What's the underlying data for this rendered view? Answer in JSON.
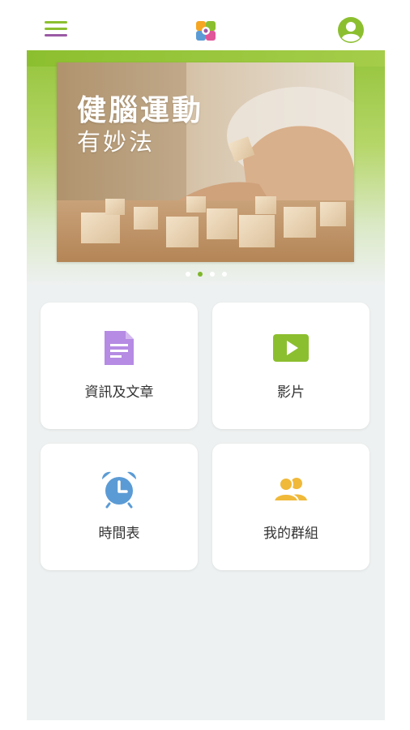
{
  "banner": {
    "title": "健腦運動",
    "subtitle": "有妙法",
    "slide_count": 4,
    "active_slide": 2
  },
  "tiles": [
    {
      "label": "資訊及文章",
      "icon": "document-icon",
      "color": "#b58be3"
    },
    {
      "label": "影片",
      "icon": "play-video-icon",
      "color": "#8cbf2f"
    },
    {
      "label": "時間表",
      "icon": "alarm-clock-icon",
      "color": "#5b9bd5"
    },
    {
      "label": "我的群組",
      "icon": "group-people-icon",
      "color": "#f0b93a"
    }
  ],
  "icons": {
    "menu": "hamburger-menu-icon",
    "logo": "app-logo-icon",
    "profile": "user-profile-icon"
  },
  "colors": {
    "brand_green": "#8cbf2f",
    "brand_purple": "#9b5aa5",
    "background": "#eef1f1"
  }
}
